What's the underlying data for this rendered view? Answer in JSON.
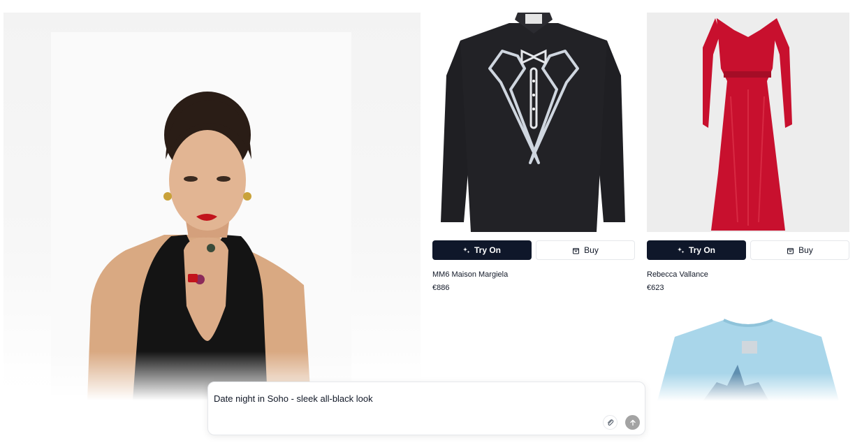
{
  "products": [
    {
      "brand": "MM6 Maison Margiela",
      "price": "€886",
      "try_on_label": "Try On",
      "buy_label": "Buy",
      "image_bg": "#ffffff"
    },
    {
      "brand": "Rebecca Vallance",
      "price": "€623",
      "try_on_label": "Try On",
      "buy_label": "Buy",
      "image_bg": "#ededed"
    }
  ],
  "chat": {
    "value": "Date night in Soho - sleek all-black look",
    "attach_icon": "paperclip-icon",
    "send_icon": "arrow-up-icon"
  },
  "colors": {
    "primary_button": "#0f172a",
    "dress_red": "#c8102e",
    "shirt_black": "#1f1f23"
  }
}
